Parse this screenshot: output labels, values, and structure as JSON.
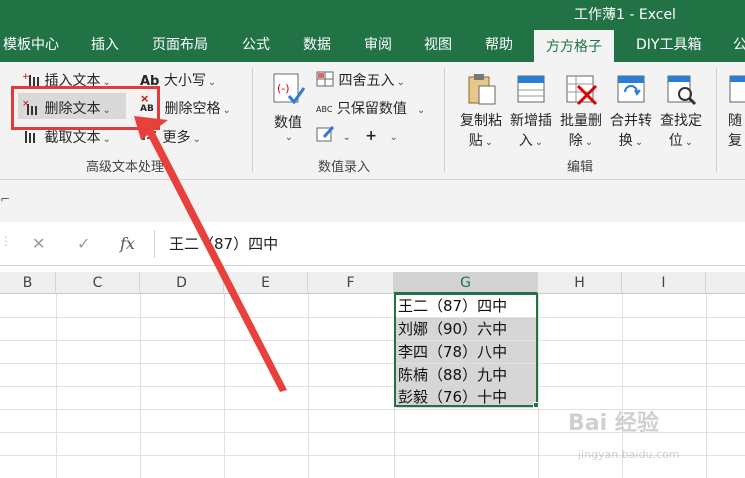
{
  "window": {
    "title": "工作薄1  -  Excel"
  },
  "tabs": [
    {
      "label": "模板中心"
    },
    {
      "label": "插入"
    },
    {
      "label": "页面布局"
    },
    {
      "label": "公式"
    },
    {
      "label": "数据"
    },
    {
      "label": "审阅"
    },
    {
      "label": "视图"
    },
    {
      "label": "帮助"
    },
    {
      "label": "方方格子",
      "active": true
    },
    {
      "label": "DIY工具箱"
    },
    {
      "label": "公"
    }
  ],
  "ribbon": {
    "text_group": {
      "insert_text": "插入文本",
      "delete_text": "删除文本",
      "cut_text": "截取文本",
      "case": "大小写",
      "delete_space": "删除空格",
      "more": "更多",
      "label": "高级文本处理"
    },
    "number_group": {
      "value_btn": "数值",
      "round": "四舍五入",
      "keep_number": "只保留数值",
      "label": "数值录入"
    },
    "edit_group": {
      "copy_paste": [
        "复制粘",
        "贴"
      ],
      "add_insert": [
        "新增插",
        "入"
      ],
      "batch_delete": [
        "批量删",
        "除"
      ],
      "merge_convert": [
        "合并转",
        "换"
      ],
      "find_locate": [
        "查找定",
        "位"
      ],
      "label": "编辑"
    },
    "partial": [
      "随",
      "复"
    ]
  },
  "formula_bar": {
    "cancel": "✕",
    "confirm": "✓",
    "fx": "fx",
    "value": "王二（87）四中"
  },
  "columns": [
    "B",
    "C",
    "D",
    "E",
    "F",
    "G",
    "H",
    "I"
  ],
  "selected_column": "G",
  "cells": [
    "王二（87）四中",
    "刘娜（90）六中",
    "李四（78）八中",
    "陈楠（88）九中",
    "彭毅（76）十中"
  ],
  "colors": {
    "accent": "#217346",
    "highlight": "#e23b3b"
  },
  "watermark": {
    "main": "Bai 经验",
    "sub": "jingyan.baidu.com"
  }
}
